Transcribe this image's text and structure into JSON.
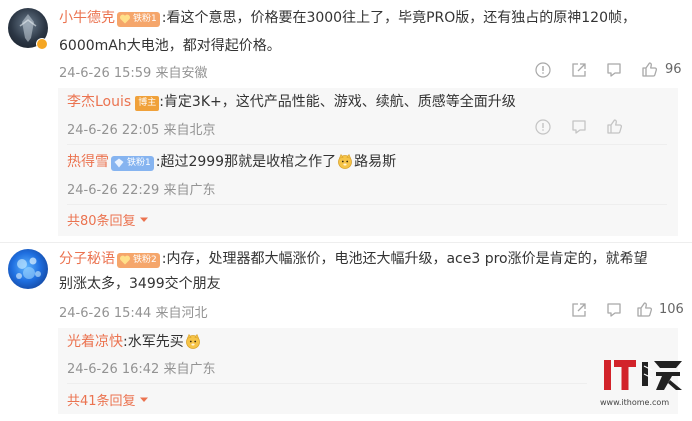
{
  "comments": [
    {
      "user": "小牛德克",
      "fan_badge": "铁粉1",
      "text_line1": ":看这个意思，价格要在3000往上了，毕竟PRO版，还有独占的原神120帧，",
      "text_line2": "6000mAh大电池，都对得起价格。",
      "meta": "24-6-26 15:59 来自安徽",
      "likes": "96",
      "replies": [
        {
          "user": "李杰Louis",
          "badge": "博主",
          "text": ":肯定3K+，这代产品性能、游戏、续航、质感等全面升级",
          "meta": "24-6-26 22:05 来自北京"
        },
        {
          "user": "热得雪",
          "fan_badge": "铁粉1",
          "text": ":超过2999那就是收棺之作了",
          "text_after": "路易斯",
          "meta": "24-6-26 22:29 来自广东"
        }
      ],
      "more_replies": "共80条回复"
    },
    {
      "user": "分子秘语",
      "fan_badge": "铁粉2",
      "text_line1": ":内存，处理器都大幅涨价，电池还大幅升级，ace3 pro涨价是肯定的，就希望",
      "text_line2": "别涨太多，3499交个朋友",
      "meta": "24-6-26 15:44 来自河北",
      "likes": "106",
      "replies": [
        {
          "user": "光着凉快",
          "text": ":水军先买",
          "meta": "24-6-26 16:42 来自广东"
        }
      ],
      "more_replies": "共41条回复"
    }
  ],
  "watermark": {
    "logo_text": "IT之家",
    "url": "www.ithome.com"
  },
  "colors": {
    "name": "#eb7350",
    "meta": "#939393",
    "reply_bg": "#f7f7f7"
  },
  "icons": [
    "report-icon",
    "share-icon",
    "comment-icon",
    "like-icon",
    "chevron-down-icon",
    "emoji-dog-icon"
  ]
}
